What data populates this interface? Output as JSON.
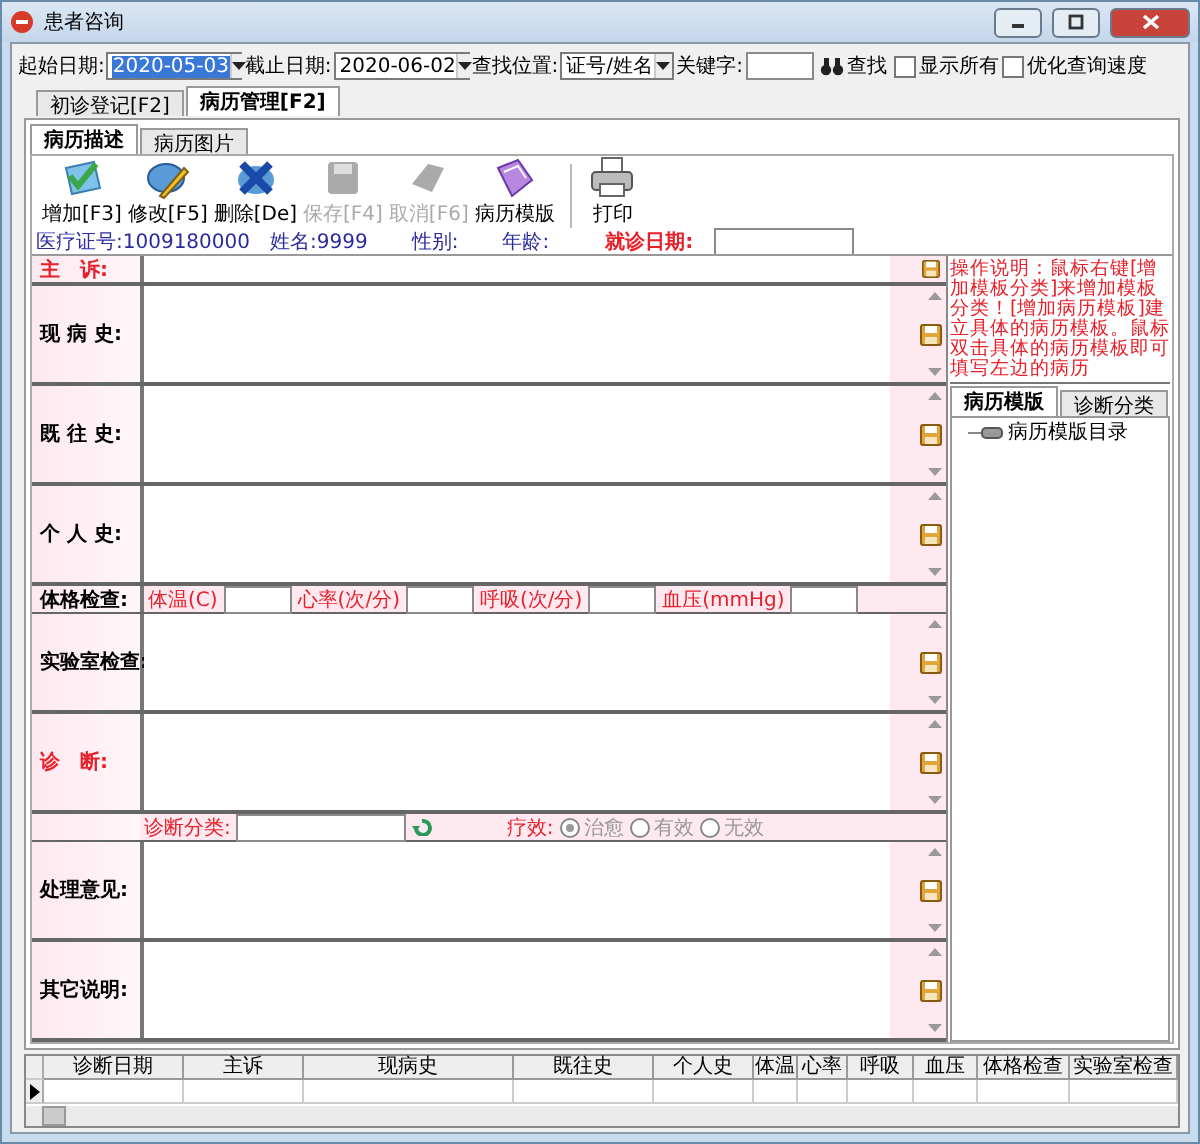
{
  "window": {
    "title": "患者咨询"
  },
  "filters": {
    "start_date": {
      "label": "起始日期:",
      "value": "2020-05-03"
    },
    "end_date": {
      "label": "截止日期:",
      "value": "2020-06-02"
    },
    "search_in": {
      "label": "查找位置:",
      "value": "证号/姓名"
    },
    "keyword": {
      "label": "关键字:"
    },
    "search_button": "查找",
    "options": [
      {
        "label": "显示所有",
        "checked": false
      },
      {
        "label": "优化查询速度",
        "checked": false
      }
    ]
  },
  "outer_tabs": [
    {
      "label": "初诊登记[F2]",
      "selected": false
    },
    {
      "label": "病历管理[F2]",
      "selected": true
    }
  ],
  "inner_tabs": [
    {
      "label": "病历描述",
      "selected": true
    },
    {
      "label": "病历图片",
      "selected": false
    }
  ],
  "toolbar": [
    {
      "kind": "add",
      "label": "增加[F3]",
      "disabled": false
    },
    {
      "kind": "edit",
      "label": "修改[F5]",
      "disabled": false
    },
    {
      "kind": "delete",
      "label": "删除[De]",
      "disabled": false
    },
    {
      "kind": "save",
      "label": "保存[F4]",
      "disabled": true
    },
    {
      "kind": "cancel",
      "label": "取消[F6]",
      "disabled": true
    },
    {
      "kind": "template",
      "label": "病历模版",
      "disabled": false
    },
    {
      "kind": "print",
      "label": "打印",
      "disabled": false
    }
  ],
  "patient": {
    "id": "医疗证号:1009180000",
    "name": "姓名:9999",
    "sex": "性别:",
    "age": "年龄:",
    "visit_date_label": "就诊日期:"
  },
  "sections": [
    {
      "kind": "line",
      "label": "主　诉:",
      "required": true
    },
    {
      "kind": "area",
      "label": "现 病 史:",
      "required": false
    },
    {
      "kind": "area",
      "label": "既 往 史:",
      "required": false
    },
    {
      "kind": "area",
      "label": "个 人 史:",
      "required": false
    },
    {
      "kind": "vitals",
      "label": "体格检查:",
      "fields": [
        "体温(C)",
        "心率(次/分)",
        "呼吸(次/分)",
        "血压(mmHg)"
      ]
    },
    {
      "kind": "area",
      "label": "实验室检查:",
      "required": false
    },
    {
      "kind": "area",
      "label": "诊　断:",
      "required": true
    },
    {
      "kind": "diagnosis",
      "label": "诊断分类:",
      "effect_label": "疗效:",
      "disabled": true,
      "outcomes": [
        {
          "label": "治愈",
          "selected": true
        },
        {
          "label": "有效",
          "selected": false
        },
        {
          "label": "无效",
          "selected": false
        }
      ]
    },
    {
      "kind": "area",
      "label": "处理意见:",
      "required": false
    },
    {
      "kind": "area",
      "label": "其它说明:",
      "required": false
    }
  ],
  "side_panel": {
    "instructions": "操作说明：鼠标右键[增加模板分类]来增加模板分类！[增加病历模板]建立具体的病历模板。鼠标双击具体的病历模板即可填写左边的病历",
    "tabs": [
      {
        "label": "病历模版",
        "selected": true
      },
      {
        "label": "诊断分类",
        "selected": false
      }
    ],
    "tree_root": "病历模版目录"
  },
  "table": {
    "columns": [
      "诊断日期",
      "主诉",
      "现病史",
      "既往史",
      "个人史",
      "体温",
      "心率",
      "呼吸",
      "血压",
      "体格检查",
      "实验室检查"
    ]
  }
}
